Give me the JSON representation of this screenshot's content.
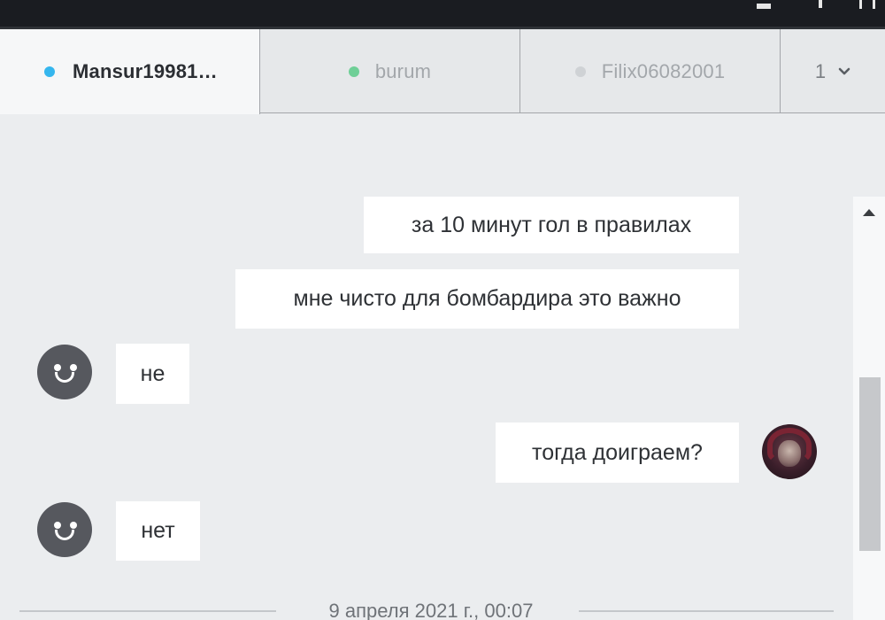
{
  "window": {
    "controls": [
      "minimize-icon",
      "maximize-icon",
      "close-icon"
    ]
  },
  "tabs": [
    {
      "label": "Mansur19981…",
      "active": true,
      "status_color": "#35b6ee"
    },
    {
      "label": "burum",
      "active": false,
      "status_color": "#6fcf97"
    },
    {
      "label": "Filix06082001",
      "active": false,
      "status_color": "#cfd2d5"
    }
  ],
  "tab_more": {
    "label": "1",
    "icon": "chevron-down-icon"
  },
  "messages": [
    {
      "sender": "me",
      "text": "за 10 минут гол в правилах"
    },
    {
      "sender": "me",
      "text": "мне чисто для бомбардира это важно"
    },
    {
      "sender": "opponent",
      "text": "не"
    },
    {
      "sender": "me",
      "text": "тогда доиграем?"
    },
    {
      "sender": "opponent",
      "text": "нет"
    }
  ],
  "date_separator": "9 апреля 2021 г., 00:07",
  "colors": {
    "background": "#ebedef",
    "bubble": "#ffffff",
    "active_tab": "#f6f7f8",
    "titlebar": "#1a1c21"
  }
}
